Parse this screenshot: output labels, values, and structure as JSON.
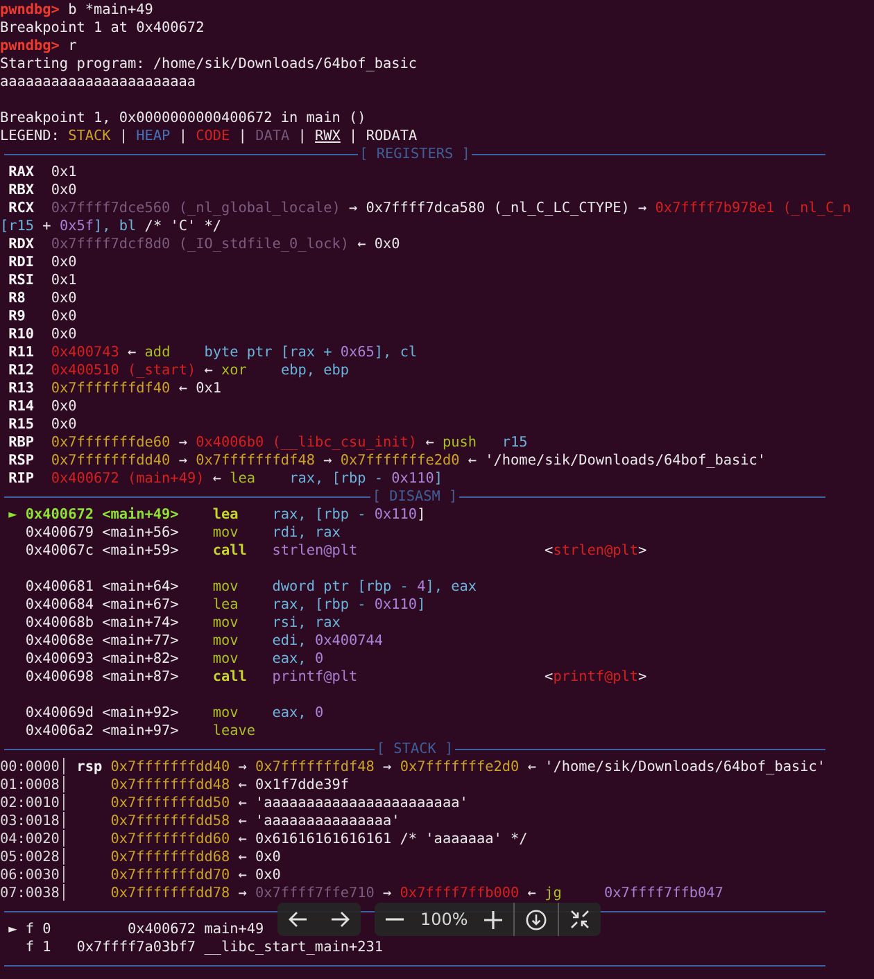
{
  "lines": [
    {
      "kind": "text",
      "segments": [
        {
          "text": "pwndbg> ",
          "kind": "prompt"
        },
        {
          "text": "b *main+49",
          "kind": "plain"
        }
      ]
    },
    {
      "kind": "text",
      "segments": [
        {
          "text": "Breakpoint 1 at 0x400672",
          "kind": "plain"
        }
      ]
    },
    {
      "kind": "text",
      "segments": [
        {
          "text": "pwndbg> ",
          "kind": "prompt"
        },
        {
          "text": "r",
          "kind": "plain"
        }
      ]
    },
    {
      "kind": "text",
      "segments": [
        {
          "text": "Starting program: /home/sik/Downloads/64bof_basic",
          "kind": "plain"
        }
      ]
    },
    {
      "kind": "text",
      "segments": [
        {
          "text": "aaaaaaaaaaaaaaaaaaaaaaa",
          "kind": "plain"
        }
      ]
    },
    {
      "kind": "blank"
    },
    {
      "kind": "text",
      "segments": [
        {
          "text": "Breakpoint 1, 0x0000000000400672 in main ()",
          "kind": "plain"
        }
      ]
    },
    {
      "kind": "text",
      "segments": [
        {
          "text": "LEGEND: ",
          "kind": "plain"
        },
        {
          "text": "STACK",
          "kind": "stack"
        },
        {
          "text": " | ",
          "kind": "plain"
        },
        {
          "text": "HEAP",
          "kind": "heap"
        },
        {
          "text": " | ",
          "kind": "plain"
        },
        {
          "text": "CODE",
          "kind": "code"
        },
        {
          "text": " | ",
          "kind": "plain"
        },
        {
          "text": "DATA",
          "kind": "data"
        },
        {
          "text": " | ",
          "kind": "plain"
        },
        {
          "text": "RWX",
          "kind": "rwx"
        },
        {
          "text": " | RODATA",
          "kind": "plain"
        }
      ]
    },
    {
      "kind": "section",
      "title": "[ REGISTERS ]"
    },
    {
      "kind": "text",
      "segments": [
        {
          "text": " RAX  ",
          "kind": "label"
        },
        {
          "text": "0x1",
          "kind": "plain"
        }
      ]
    },
    {
      "kind": "text",
      "segments": [
        {
          "text": " RBX  ",
          "kind": "label"
        },
        {
          "text": "0x0",
          "kind": "plain"
        }
      ]
    },
    {
      "kind": "text",
      "segments": [
        {
          "text": " RCX  ",
          "kind": "label"
        },
        {
          "text": "0x7ffff7dce560 (_nl_global_locale)",
          "kind": "dim"
        },
        {
          "text": " → 0x7ffff7dca580 (_nl_C_LC_CTYPE) → ",
          "kind": "plain"
        },
        {
          "text": "0x7ffff7b978e1 (_nl_C_n",
          "kind": "code"
        }
      ]
    },
    {
      "kind": "text",
      "segments": [
        {
          "text": "[r15",
          "kind": "register"
        },
        {
          "text": " + ",
          "kind": "plain"
        },
        {
          "text": "0x5f",
          "kind": "number"
        },
        {
          "text": "], bl",
          "kind": "register"
        },
        {
          "text": " /* 'C' */",
          "kind": "plain"
        }
      ]
    },
    {
      "kind": "text",
      "segments": [
        {
          "text": " RDX  ",
          "kind": "label"
        },
        {
          "text": "0x7ffff7dcf8d0 (_IO_stdfile_0_lock)",
          "kind": "dim"
        },
        {
          "text": " ← 0x0",
          "kind": "plain"
        }
      ]
    },
    {
      "kind": "text",
      "segments": [
        {
          "text": " RDI  ",
          "kind": "label"
        },
        {
          "text": "0x0",
          "kind": "plain"
        }
      ]
    },
    {
      "kind": "text",
      "segments": [
        {
          "text": " RSI  ",
          "kind": "label"
        },
        {
          "text": "0x1",
          "kind": "plain"
        }
      ]
    },
    {
      "kind": "text",
      "segments": [
        {
          "text": " R8   ",
          "kind": "label"
        },
        {
          "text": "0x0",
          "kind": "plain"
        }
      ]
    },
    {
      "kind": "text",
      "segments": [
        {
          "text": " R9   ",
          "kind": "label"
        },
        {
          "text": "0x0",
          "kind": "plain"
        }
      ]
    },
    {
      "kind": "text",
      "segments": [
        {
          "text": " R10  ",
          "kind": "label"
        },
        {
          "text": "0x0",
          "kind": "plain"
        }
      ]
    },
    {
      "kind": "text",
      "segments": [
        {
          "text": " R11  ",
          "kind": "label"
        },
        {
          "text": "0x400743",
          "kind": "code"
        },
        {
          "text": " ← ",
          "kind": "plain"
        },
        {
          "text": "add",
          "kind": "mnemonic"
        },
        {
          "text": "    byte ptr [rax + ",
          "kind": "register"
        },
        {
          "text": "0x65",
          "kind": "number"
        },
        {
          "text": "], cl",
          "kind": "register"
        }
      ]
    },
    {
      "kind": "text",
      "segments": [
        {
          "text": " R12  ",
          "kind": "label"
        },
        {
          "text": "0x400510 (_start)",
          "kind": "code"
        },
        {
          "text": " ← ",
          "kind": "plain"
        },
        {
          "text": "xor",
          "kind": "mnemonic"
        },
        {
          "text": "    ebp, ebp",
          "kind": "register"
        }
      ]
    },
    {
      "kind": "text",
      "segments": [
        {
          "text": " R13  ",
          "kind": "label"
        },
        {
          "text": "0x7fffffffdf40",
          "kind": "stack"
        },
        {
          "text": " ← 0x1",
          "kind": "plain"
        }
      ]
    },
    {
      "kind": "text",
      "segments": [
        {
          "text": " R14  ",
          "kind": "label"
        },
        {
          "text": "0x0",
          "kind": "plain"
        }
      ]
    },
    {
      "kind": "text",
      "segments": [
        {
          "text": " R15  ",
          "kind": "label"
        },
        {
          "text": "0x0",
          "kind": "plain"
        }
      ]
    },
    {
      "kind": "text",
      "segments": [
        {
          "text": " RBP  ",
          "kind": "label"
        },
        {
          "text": "0x7fffffffde60",
          "kind": "stack"
        },
        {
          "text": " → ",
          "kind": "plain"
        },
        {
          "text": "0x4006b0 (__libc_csu_init)",
          "kind": "code"
        },
        {
          "text": " ← ",
          "kind": "plain"
        },
        {
          "text": "push",
          "kind": "mnemonic"
        },
        {
          "text": "   r15",
          "kind": "register"
        }
      ]
    },
    {
      "kind": "text",
      "segments": [
        {
          "text": " RSP  ",
          "kind": "label"
        },
        {
          "text": "0x7fffffffdd40",
          "kind": "stack"
        },
        {
          "text": " → ",
          "kind": "plain"
        },
        {
          "text": "0x7fffffffdf48",
          "kind": "stack"
        },
        {
          "text": " → ",
          "kind": "plain"
        },
        {
          "text": "0x7fffffffe2d0",
          "kind": "stack"
        },
        {
          "text": " ← '/home/sik/Downloads/64bof_basic'",
          "kind": "plain"
        }
      ]
    },
    {
      "kind": "text",
      "segments": [
        {
          "text": " RIP  ",
          "kind": "label"
        },
        {
          "text": "0x400672 (main+49)",
          "kind": "code"
        },
        {
          "text": " ← ",
          "kind": "plain"
        },
        {
          "text": "lea",
          "kind": "mnemonic"
        },
        {
          "text": "    rax, [rbp - ",
          "kind": "register"
        },
        {
          "text": "0x110",
          "kind": "number"
        },
        {
          "text": "]",
          "kind": "register"
        }
      ]
    },
    {
      "kind": "section",
      "title": "[ DISASM ]"
    },
    {
      "kind": "text",
      "segments": [
        {
          "text": " ► 0x400672 <main+49>",
          "kind": "current"
        },
        {
          "text": "    lea",
          "kind": "call"
        },
        {
          "text": "    rax, [rbp - ",
          "kind": "register"
        },
        {
          "text": "0x110",
          "kind": "number"
        },
        {
          "text": "]",
          "kind": "plain"
        }
      ]
    },
    {
      "kind": "text",
      "segments": [
        {
          "text": "   0x400679 <main+56>    ",
          "kind": "plain"
        },
        {
          "text": "mov",
          "kind": "mnemonic"
        },
        {
          "text": "    rdi, rax",
          "kind": "register"
        }
      ]
    },
    {
      "kind": "text",
      "segments": [
        {
          "text": "   0x40067c <main+59>    ",
          "kind": "plain"
        },
        {
          "text": "call",
          "kind": "call"
        },
        {
          "text": "   strlen@plt",
          "kind": "symbol"
        },
        {
          "text": "                      <",
          "kind": "plain"
        },
        {
          "text": "strlen@plt",
          "kind": "code"
        },
        {
          "text": ">",
          "kind": "plain"
        }
      ]
    },
    {
      "kind": "blank"
    },
    {
      "kind": "text",
      "segments": [
        {
          "text": "   0x400681 <main+64>    ",
          "kind": "plain"
        },
        {
          "text": "mov",
          "kind": "mnemonic"
        },
        {
          "text": "    dword ptr [rbp - ",
          "kind": "register"
        },
        {
          "text": "4",
          "kind": "number"
        },
        {
          "text": "], eax",
          "kind": "register"
        }
      ]
    },
    {
      "kind": "text",
      "segments": [
        {
          "text": "   0x400684 <main+67>    ",
          "kind": "plain"
        },
        {
          "text": "lea",
          "kind": "mnemonic"
        },
        {
          "text": "    rax, [rbp - ",
          "kind": "register"
        },
        {
          "text": "0x110",
          "kind": "number"
        },
        {
          "text": "]",
          "kind": "register"
        }
      ]
    },
    {
      "kind": "text",
      "segments": [
        {
          "text": "   0x40068b <main+74>    ",
          "kind": "plain"
        },
        {
          "text": "mov",
          "kind": "mnemonic"
        },
        {
          "text": "    rsi, rax",
          "kind": "register"
        }
      ]
    },
    {
      "kind": "text",
      "segments": [
        {
          "text": "   0x40068e <main+77>    ",
          "kind": "plain"
        },
        {
          "text": "mov",
          "kind": "mnemonic"
        },
        {
          "text": "    edi, ",
          "kind": "register"
        },
        {
          "text": "0x400744",
          "kind": "number"
        }
      ]
    },
    {
      "kind": "text",
      "segments": [
        {
          "text": "   0x400693 <main+82>    ",
          "kind": "plain"
        },
        {
          "text": "mov",
          "kind": "mnemonic"
        },
        {
          "text": "    eax, ",
          "kind": "register"
        },
        {
          "text": "0",
          "kind": "number"
        }
      ]
    },
    {
      "kind": "text",
      "segments": [
        {
          "text": "   0x400698 <main+87>    ",
          "kind": "plain"
        },
        {
          "text": "call",
          "kind": "call"
        },
        {
          "text": "   printf@plt",
          "kind": "symbol"
        },
        {
          "text": "                      <",
          "kind": "plain"
        },
        {
          "text": "printf@plt",
          "kind": "code"
        },
        {
          "text": ">",
          "kind": "plain"
        }
      ]
    },
    {
      "kind": "blank"
    },
    {
      "kind": "text",
      "segments": [
        {
          "text": "   0x40069d <main+92>    ",
          "kind": "plain"
        },
        {
          "text": "mov",
          "kind": "mnemonic"
        },
        {
          "text": "    eax, ",
          "kind": "register"
        },
        {
          "text": "0",
          "kind": "number"
        }
      ]
    },
    {
      "kind": "text",
      "segments": [
        {
          "text": "   0x4006a2 <main+97>    ",
          "kind": "plain"
        },
        {
          "text": "leave",
          "kind": "mnemonic"
        }
      ]
    },
    {
      "kind": "section",
      "title": "[ STACK ]"
    },
    {
      "kind": "text",
      "segments": [
        {
          "text": "00:0000│ ",
          "kind": "gutter"
        },
        {
          "text": "rsp ",
          "kind": "label"
        },
        {
          "text": "0x7fffffffdd40",
          "kind": "stack"
        },
        {
          "text": " → ",
          "kind": "plain"
        },
        {
          "text": "0x7fffffffdf48",
          "kind": "stack"
        },
        {
          "text": " → ",
          "kind": "plain"
        },
        {
          "text": "0x7fffffffe2d0",
          "kind": "stack"
        },
        {
          "text": " ← '/home/sik/Downloads/64bof_basic'",
          "kind": "plain"
        }
      ]
    },
    {
      "kind": "text",
      "segments": [
        {
          "text": "01:0008│     ",
          "kind": "gutter"
        },
        {
          "text": "0x7fffffffdd48",
          "kind": "stack"
        },
        {
          "text": " ← 0x1f7dde39f",
          "kind": "plain"
        }
      ]
    },
    {
      "kind": "text",
      "segments": [
        {
          "text": "02:0010│     ",
          "kind": "gutter"
        },
        {
          "text": "0x7fffffffdd50",
          "kind": "stack"
        },
        {
          "text": " ← 'aaaaaaaaaaaaaaaaaaaaaaa'",
          "kind": "plain"
        }
      ]
    },
    {
      "kind": "text",
      "segments": [
        {
          "text": "03:0018│     ",
          "kind": "gutter"
        },
        {
          "text": "0x7fffffffdd58",
          "kind": "stack"
        },
        {
          "text": " ← 'aaaaaaaaaaaaaaa'",
          "kind": "plain"
        }
      ]
    },
    {
      "kind": "text",
      "segments": [
        {
          "text": "04:0020│     ",
          "kind": "gutter"
        },
        {
          "text": "0x7fffffffdd60",
          "kind": "stack"
        },
        {
          "text": " ← 0x61616161616161 /* 'aaaaaaa' */",
          "kind": "plain"
        }
      ]
    },
    {
      "kind": "text",
      "segments": [
        {
          "text": "05:0028│     ",
          "kind": "gutter"
        },
        {
          "text": "0x7fffffffdd68",
          "kind": "stack"
        },
        {
          "text": " ← 0x0",
          "kind": "plain"
        }
      ]
    },
    {
      "kind": "text",
      "segments": [
        {
          "text": "06:0030│     ",
          "kind": "gutter"
        },
        {
          "text": "0x7fffffffdd70",
          "kind": "stack"
        },
        {
          "text": " ← 0x0",
          "kind": "plain"
        }
      ]
    },
    {
      "kind": "text",
      "segments": [
        {
          "text": "07:0038│     ",
          "kind": "gutter"
        },
        {
          "text": "0x7fffffffdd78",
          "kind": "stack"
        },
        {
          "text": " → ",
          "kind": "plain"
        },
        {
          "text": "0x7ffff7ffe710",
          "kind": "dim"
        },
        {
          "text": " → ",
          "kind": "plain"
        },
        {
          "text": "0x7ffff7ffb000",
          "kind": "code"
        },
        {
          "text": " ← ",
          "kind": "plain"
        },
        {
          "text": "jg",
          "kind": "mnemonic"
        },
        {
          "text": "     0x7ffff7ffb047",
          "kind": "symbol"
        }
      ]
    },
    {
      "kind": "section"
    },
    {
      "kind": "text",
      "segments": [
        {
          "text": " ► f 0         0x400672 main+49",
          "kind": "plain"
        }
      ]
    },
    {
      "kind": "text",
      "segments": [
        {
          "text": "   f 1   0x7ffff7a03bf7 __libc_start_main+231",
          "kind": "plain"
        }
      ]
    },
    {
      "kind": "section"
    }
  ],
  "viewer_toolbar": {
    "zoom": "100%"
  }
}
